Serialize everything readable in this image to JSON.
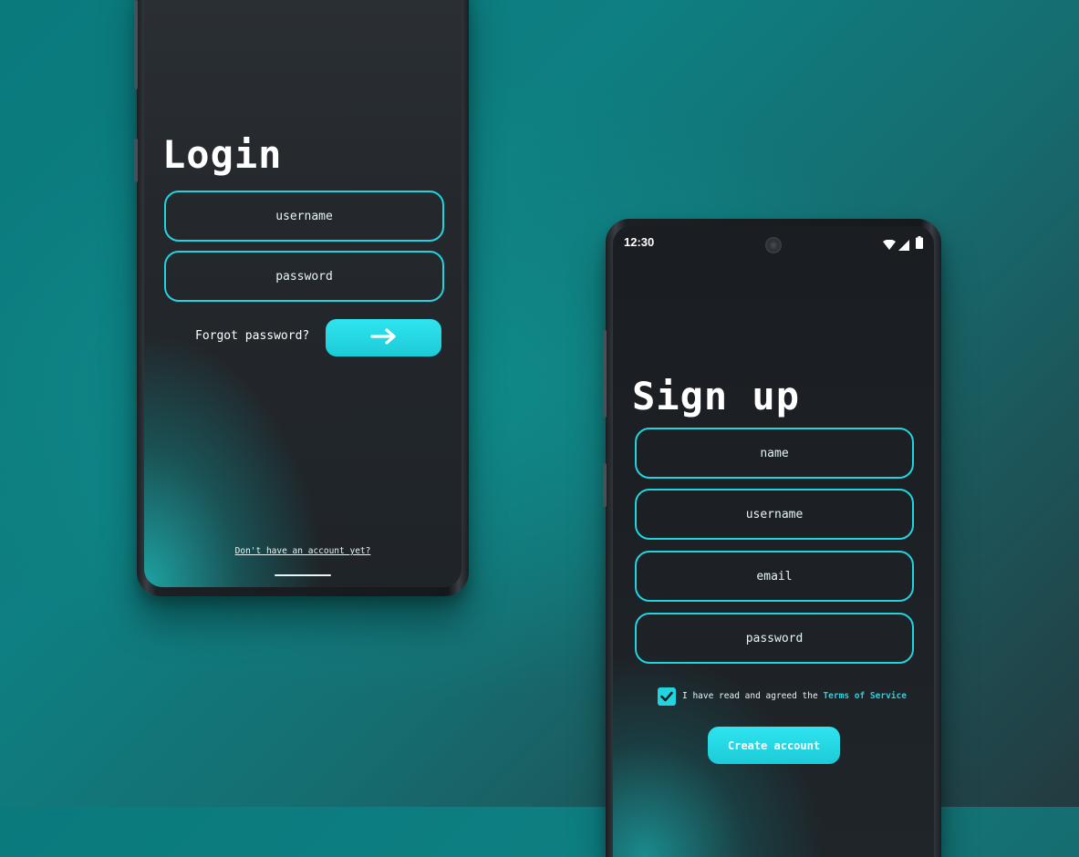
{
  "login": {
    "title": "Login",
    "username_placeholder": "username",
    "password_placeholder": "password",
    "forgot_password": "Forgot password?",
    "no_account_link": "Don't have an account yet?"
  },
  "signup": {
    "status_time": "12:30",
    "title": "Sign up",
    "name_placeholder": "name",
    "username_placeholder": "username",
    "email_placeholder": "email",
    "password_placeholder": "password",
    "terms_prefix": "I have read and agreed the",
    "terms_link": "Terms of Service",
    "terms_checked": true,
    "create_button": "Create account"
  },
  "icons": {
    "submit": "arrow-right-icon",
    "wifi": "wifi-icon",
    "signal": "cell-signal-icon",
    "battery": "battery-icon",
    "checkbox": "check-icon"
  },
  "colors": {
    "accent": "#22d4e0",
    "background": "#0e7f82",
    "screen": "#1d2125"
  }
}
